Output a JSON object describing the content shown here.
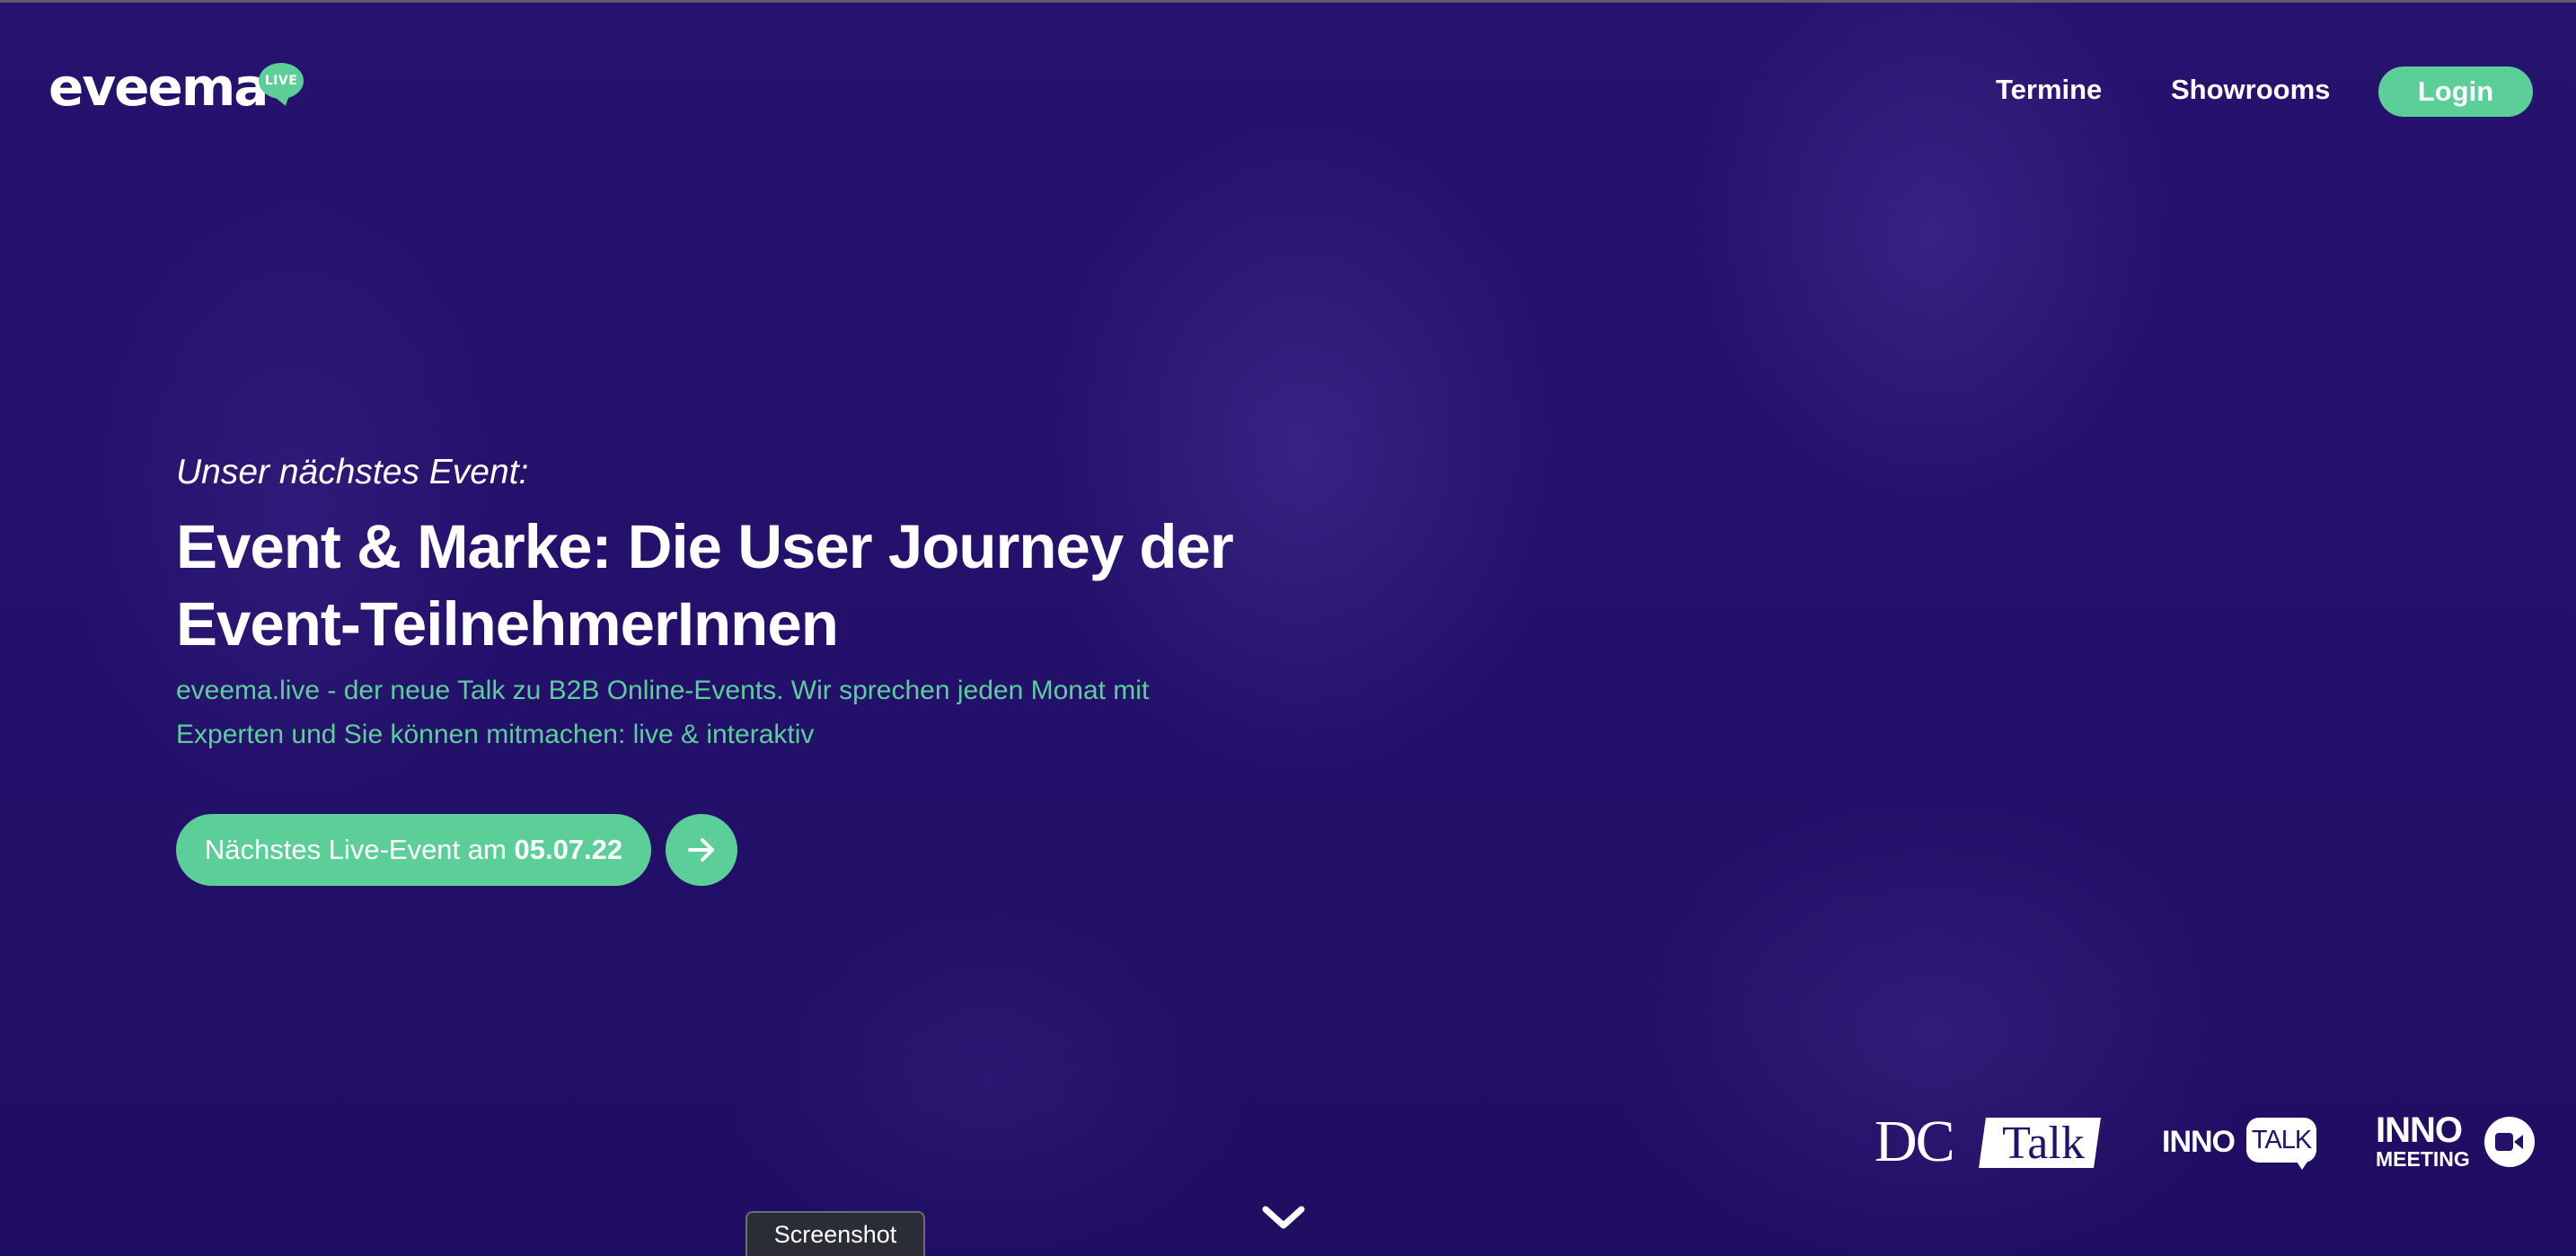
{
  "colors": {
    "background": "#24116b",
    "accent": "#5ccf98",
    "text": "#ffffff"
  },
  "header": {
    "logo_text": "eveema",
    "logo_badge": "LIVE",
    "nav": [
      {
        "label": "Termine"
      },
      {
        "label": "Showrooms"
      }
    ],
    "login_label": "Login"
  },
  "hero": {
    "eyebrow": "Unser nächstes Event:",
    "headline": "Event & Marke: Die User Journey der Event-TeilnehmerInnen",
    "lead": "eveema.live - der neue Talk zu B2B Online-Events. Wir sprechen jeden Monat mit Experten und Sie können mitmachen: live & interaktiv",
    "cta_label": "Nächstes Live-Event am",
    "cta_date": "05.07.22",
    "cta_arrow_icon": "arrow-right-icon",
    "scroll_icon": "chevron-down-icon"
  },
  "partners": {
    "dc_talk": {
      "part1": "DC",
      "part2": "Talk"
    },
    "inno_talk": {
      "part1": "INNO",
      "part2": "TALK"
    },
    "inno_meeting": {
      "line1": "INNO",
      "line2": "MEETING",
      "icon": "video-camera-icon"
    }
  },
  "tooltip": {
    "label": "Screenshot"
  }
}
